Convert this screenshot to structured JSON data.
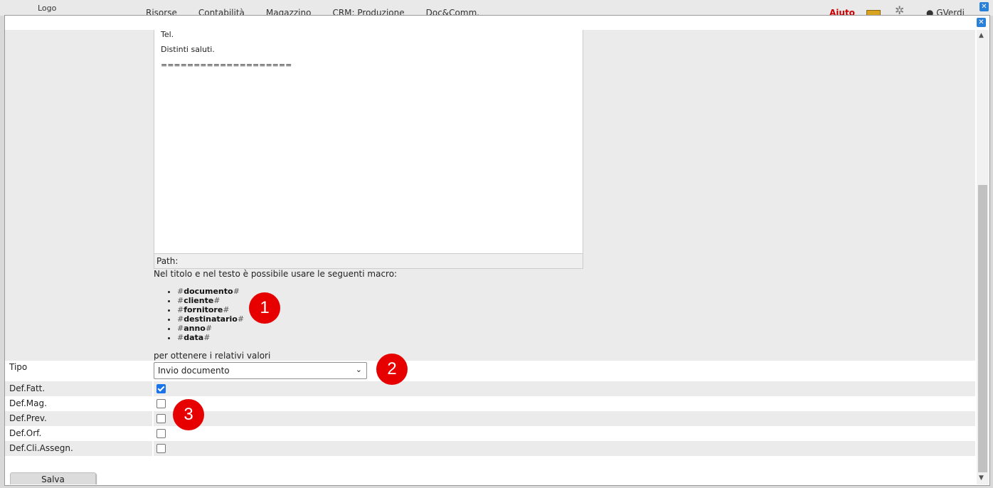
{
  "topbar": {
    "logo": "Logo",
    "menu": [
      "Risorse",
      "Contabilità",
      "Magazzino",
      "CRM: Produzione",
      "Doc&Comm."
    ],
    "help": "Aiuto",
    "user": "GVerdi"
  },
  "editor": {
    "lines": [
      "Tel.",
      "Distinti saluti.",
      "===================="
    ],
    "path_label": "Path:"
  },
  "macros": {
    "intro": "Nel titolo e nel testo è possibile usare le seguenti macro:",
    "items": [
      "documento",
      "cliente",
      "fornitore",
      "destinatario",
      "anno",
      "data"
    ],
    "outro": "per ottenere i relativi valori"
  },
  "form": {
    "tipo_label": "Tipo",
    "tipo_value": "Invio documento",
    "checkboxes": [
      {
        "label": "Def.Fatt.",
        "checked": true
      },
      {
        "label": "Def.Mag.",
        "checked": false
      },
      {
        "label": "Def.Prev.",
        "checked": false
      },
      {
        "label": "Def.Orf.",
        "checked": false
      },
      {
        "label": "Def.Cli.Assegn.",
        "checked": false
      }
    ],
    "save_label": "Salva"
  },
  "annotations": [
    "1",
    "2",
    "3"
  ],
  "colors": {
    "accent": "#1a73e8",
    "annotation": "#e60000",
    "help": "#cc0000"
  }
}
